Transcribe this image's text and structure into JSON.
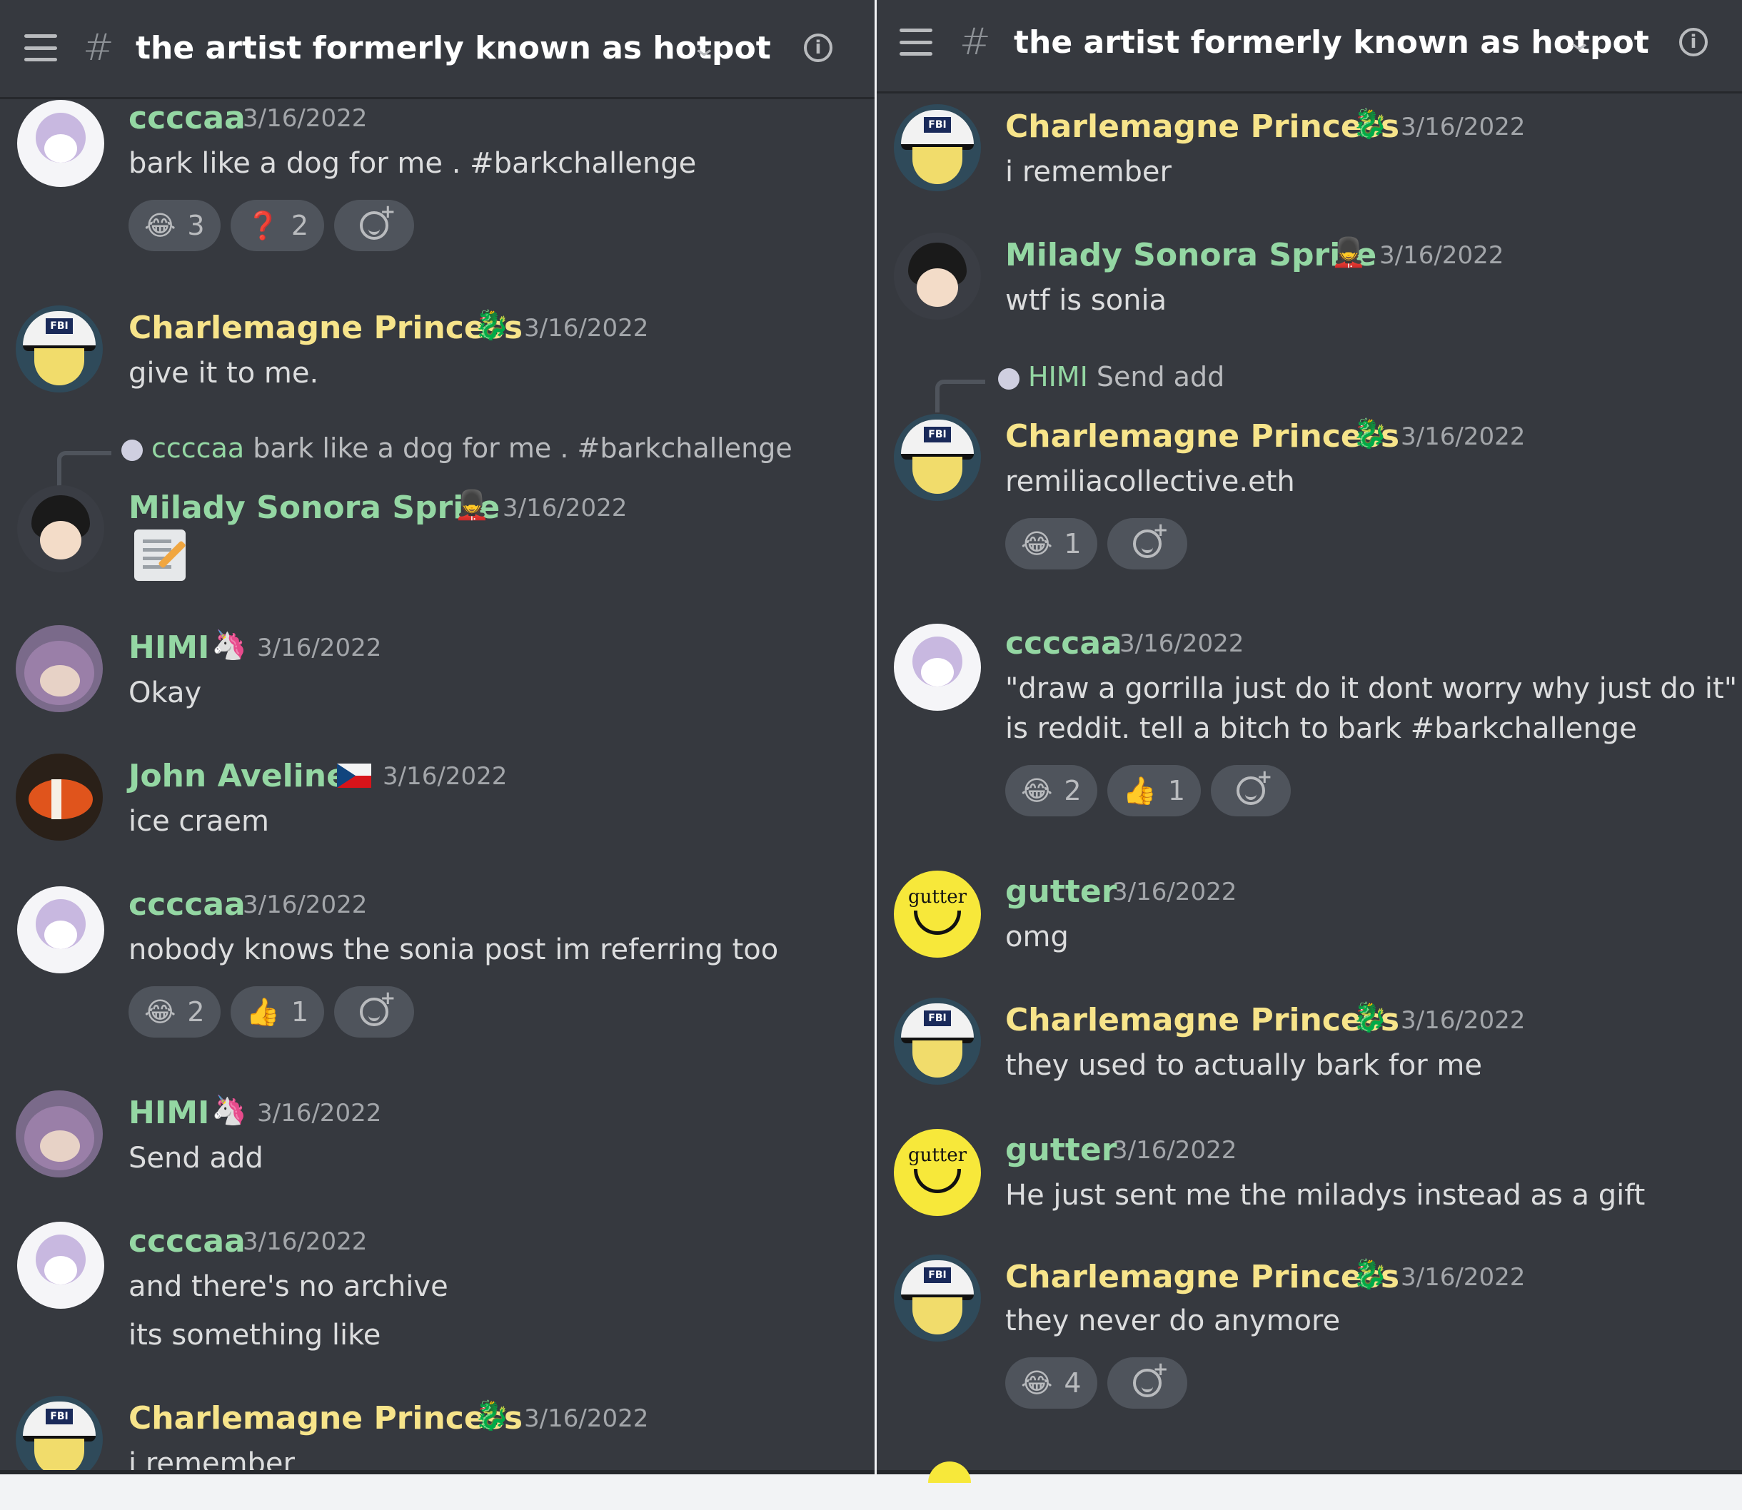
{
  "channel": {
    "title": "the artist formerly known as hotpot",
    "hash": "#"
  },
  "icons": {
    "role_snake": "🐉",
    "role_unicorn": "🦄",
    "role_milady": "💂",
    "laugh": "😂",
    "question": "❓",
    "thumbs_up": "👍"
  },
  "colors": {
    "background": "#36393f",
    "username_green": "#94d7a3",
    "username_gold": "#f7e48a",
    "timestamp": "#a3a6aa"
  },
  "left": {
    "messages": [
      {
        "user": "ccccaa",
        "time": "3/16/2022",
        "text": "bark like a dog for me .  #barkchallenge",
        "reactions": [
          {
            "emoji": "😂",
            "count": "3"
          },
          {
            "emoji": "❓",
            "count": "2"
          }
        ]
      },
      {
        "user": "Charlemagne Princess",
        "time": "3/16/2022",
        "text": "give it to me."
      },
      {
        "reply_user": "ccccaa",
        "reply_text": "bark like a dog for me .  #barkchallenge",
        "user": "Milady Sonora Sprite",
        "time": "3/16/2022"
      },
      {
        "user": "HIMI",
        "time": "3/16/2022",
        "text": "Okay"
      },
      {
        "user": "John Aveline",
        "time": "3/16/2022",
        "text": "ice craem"
      },
      {
        "user": "ccccaa",
        "time": "3/16/2022",
        "text": "nobody knows the sonia post im referring too",
        "reactions": [
          {
            "emoji": "😂",
            "count": "2"
          },
          {
            "emoji": "👍",
            "count": "1"
          }
        ]
      },
      {
        "user": "HIMI",
        "time": "3/16/2022",
        "text": "Send add"
      },
      {
        "user": "ccccaa",
        "time": "3/16/2022",
        "text": "and there's no archive",
        "text2": "its something like"
      },
      {
        "user": "Charlemagne Princess",
        "time": "3/16/2022",
        "text": "i remember"
      }
    ]
  },
  "right": {
    "messages": [
      {
        "user": "Charlemagne Princess",
        "time": "3/16/2022",
        "text": "i remember"
      },
      {
        "user": "Milady Sonora Sprite",
        "time": "3/16/2022",
        "text": "wtf is sonia"
      },
      {
        "reply_user": "HIMI",
        "reply_text": "Send add",
        "user": "Charlemagne Princess",
        "time": "3/16/2022",
        "text": "remiliacollective.eth",
        "reactions": [
          {
            "emoji": "😂",
            "count": "1"
          }
        ]
      },
      {
        "user": "ccccaa",
        "time": "3/16/2022",
        "text": "\"draw a gorrilla just do it dont worry why just do it\"",
        "text2": "is reddit. tell a bitch to bark #barkchallenge",
        "reactions": [
          {
            "emoji": "😂",
            "count": "2"
          },
          {
            "emoji": "👍",
            "count": "1"
          }
        ]
      },
      {
        "user": "gutter",
        "time": "3/16/2022",
        "text": "omg"
      },
      {
        "user": "Charlemagne Princess",
        "time": "3/16/2022",
        "text": "they used to actually bark for me"
      },
      {
        "user": "gutter",
        "time": "3/16/2022",
        "text": "He just sent me the miladys instead as a gift"
      },
      {
        "user": "Charlemagne Princess",
        "time": "3/16/2022",
        "text": "they never do anymore",
        "reactions": [
          {
            "emoji": "😂",
            "count": "4"
          }
        ]
      }
    ]
  },
  "avatar_labels": {
    "gutter": "gutter",
    "fbi": "FBI"
  }
}
